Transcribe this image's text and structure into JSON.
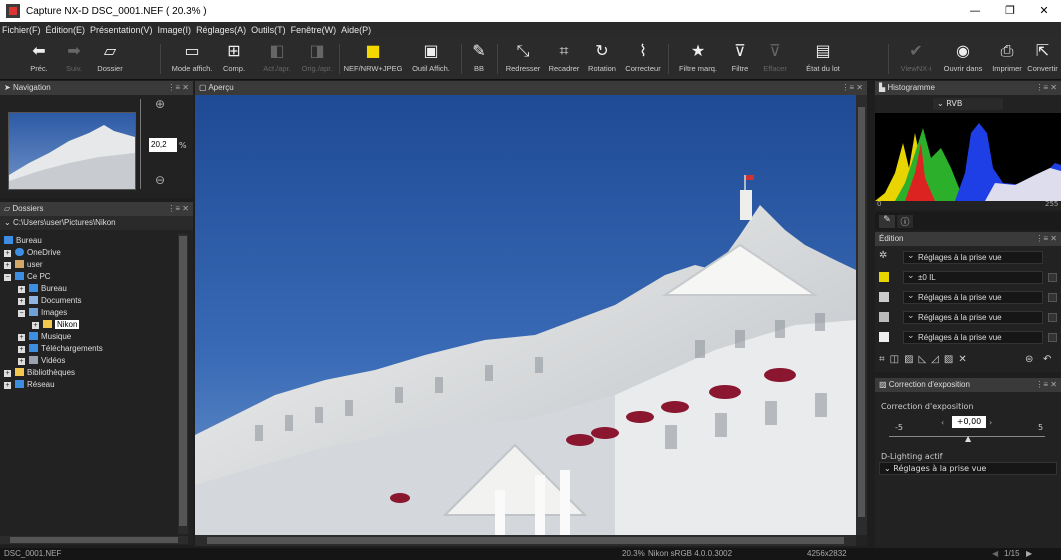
{
  "window": {
    "title": "Capture NX-D   DSC_0001.NEF ( 20.3% )"
  },
  "menu": [
    "Fichier(F)",
    "Édition(E)",
    "Présentation(V)",
    "Image(I)",
    "Réglages(A)",
    "Outils(T)",
    "Fenêtre(W)",
    "Aide(P)"
  ],
  "toolbar": {
    "prev": "Préc.",
    "next": "Suiv.",
    "folder": "Dossier",
    "display_mode": "Mode affich.",
    "compare": "Comp.",
    "act_apr": "Act./apr.",
    "orig_apr": "Orig./apr.",
    "nef_jpeg": "NEF/NRW+JPEG",
    "tool_display": "Outil Affich.",
    "wb": "BB",
    "straighten": "Redresser",
    "crop": "Recadrer",
    "rotate": "Rotation",
    "retouch": "Correcteur",
    "filter_mark": "Filtre marq.",
    "filter": "Filtre",
    "clear": "Effacer",
    "batch": "État du lot",
    "viewnx": "ViewNX-i",
    "open_in": "Ouvrir dans",
    "print": "Imprimer",
    "convert": "Convertir"
  },
  "navigation": {
    "title": "Navigation",
    "zoom_value": "20,2",
    "zoom_unit": "%"
  },
  "folders": {
    "title": "Dossiers",
    "path": "C:\\Users\\user\\Pictures\\Nikon",
    "items": [
      "Bureau",
      "OneDrive",
      "user",
      "Ce PC",
      "Bureau",
      "Documents",
      "Images",
      "Nikon",
      "Musique",
      "Téléchargements",
      "Vidéos",
      "Bibliothèques",
      "Réseau"
    ]
  },
  "preview": {
    "title": "Aperçu"
  },
  "histogram": {
    "title": "Histogramme",
    "channel": "RVB",
    "min": "0",
    "max": "255"
  },
  "edit": {
    "title": "Édition",
    "rows": [
      "Réglages à la prise vue",
      "±0 IL",
      "Réglages à la prise vue",
      "Réglages à la prise vue",
      "Réglages à la prise vue"
    ]
  },
  "exposure": {
    "title": "Correction d'exposition",
    "label": "Correction d'exposition",
    "value": "+0,00",
    "min": "-5",
    "max": "5",
    "dlighting_label": "D-Lighting actif",
    "dlighting_value": "Réglages à la prise vue"
  },
  "status": {
    "filename": "DSC_0001.NEF",
    "zoom": "20.3%",
    "profile": "Nikon sRGB 4.0.0.3002",
    "dimensions": "4256x2832",
    "page": "1/15"
  }
}
